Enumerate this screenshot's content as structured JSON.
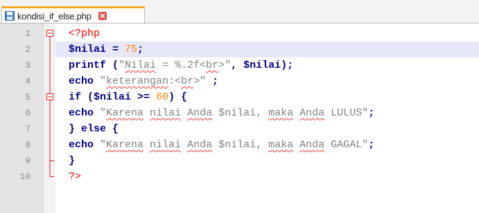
{
  "tab": {
    "filename": "kondisi_if_else.php",
    "icon": "save-disk-icon",
    "close_icon": "close-x-icon"
  },
  "colors": {
    "keyword": "#00008b",
    "variable": "#000080",
    "number": "#ff8000",
    "string": "#808080",
    "php_tag": "#ff0000",
    "current_line": "#e6e8fa",
    "gutter": "#e4e4e4",
    "tab_accent": "#f5a623"
  },
  "lines": [
    {
      "num": "1",
      "fold": "box-minus"
    },
    {
      "num": "2",
      "fold": "line",
      "current": true
    },
    {
      "num": "3",
      "fold": "line"
    },
    {
      "num": "4",
      "fold": "line"
    },
    {
      "num": "5",
      "fold": "box-minus"
    },
    {
      "num": "6",
      "fold": "line"
    },
    {
      "num": "7",
      "fold": "line"
    },
    {
      "num": "8",
      "fold": "line"
    },
    {
      "num": "9",
      "fold": "branch-end"
    },
    {
      "num": "10",
      "fold": "end"
    }
  ],
  "code": {
    "l1": {
      "open_tag": "<?php"
    },
    "l2": {
      "var": "$nilai",
      "op": " = ",
      "num": "75",
      "semi": ";"
    },
    "l3": {
      "fn": "printf",
      "paren_open": " (",
      "str_a": "\"",
      "str_sq": "Nilai",
      "str_b": " = %.2f<",
      "str_sq2": "br",
      "str_c": ">\"",
      "comma": ", ",
      "var": "$nilai",
      "close": ");"
    },
    "l4": {
      "kw": "echo",
      "sp": " ",
      "str_a": "\"",
      "str_sq": "keterangan",
      "str_b": ":<",
      "str_sq2": "br",
      "str_c": ">\"",
      "tail": " ;"
    },
    "l5": {
      "kw": "if",
      "paren": " (",
      "var": "$nilai",
      "op": " >= ",
      "num": "60",
      "close": ") {"
    },
    "l6": {
      "kw": "echo",
      "sp": " ",
      "q": "\"",
      "w1": "Karena",
      "s1": " ",
      "w2": "nilai",
      "s2": " ",
      "w3": "Anda",
      "s3": " $nilai, ",
      "w4": "maka",
      "s4": " ",
      "w5": "Anda",
      "rest": " LULUS\"",
      "semi": ";"
    },
    "l7": {
      "brace": "} ",
      "kw": "else",
      "open": " {"
    },
    "l8": {
      "kw": "echo",
      "sp": " ",
      "q": "\"",
      "w1": "Karena",
      "s1": " ",
      "w2": "nilai",
      "s2": " ",
      "w3": "Anda",
      "s3": " $nilai, ",
      "w4": "maka",
      "s4": " ",
      "w5": "Anda",
      "rest": " GAGAL\"",
      "semi": ";"
    },
    "l9": {
      "brace": "}"
    },
    "l10": {
      "close_tag": "?>"
    }
  }
}
